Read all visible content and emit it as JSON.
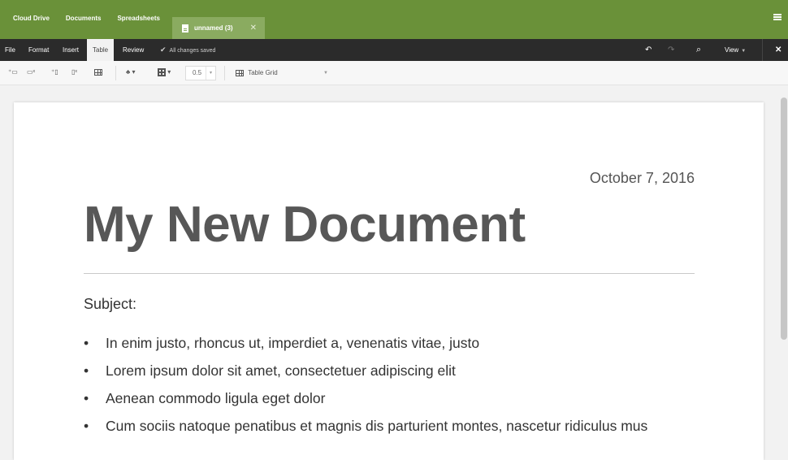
{
  "topnav": {
    "items": [
      "Cloud Drive",
      "Documents",
      "Spreadsheets"
    ]
  },
  "doc_tab": {
    "title": "unnamed (3)",
    "close": "✕"
  },
  "menubar": {
    "items": [
      "File",
      "Format",
      "Insert",
      "Table",
      "Review"
    ],
    "active": "Table",
    "status": "All changes saved",
    "view_label": "View"
  },
  "toolbar": {
    "border_width": "0.5",
    "table_style": "Table Grid"
  },
  "document": {
    "date": "October 7, 2016",
    "title": "My New Document",
    "subject_label": "Subject:",
    "bullets": [
      "In enim justo, rhoncus ut, imperdiet a, venenatis vitae, justo",
      "Lorem ipsum dolor sit amet, consectetuer adipiscing elit",
      "Aenean commodo ligula eget dolor",
      "Cum sociis natoque penatibus et magnis dis parturient montes, nascetur ridiculus mus"
    ]
  },
  "colors": {
    "topbar": "#6a9139",
    "menubar": "#2b2b2b",
    "tab": "#8aab60"
  }
}
